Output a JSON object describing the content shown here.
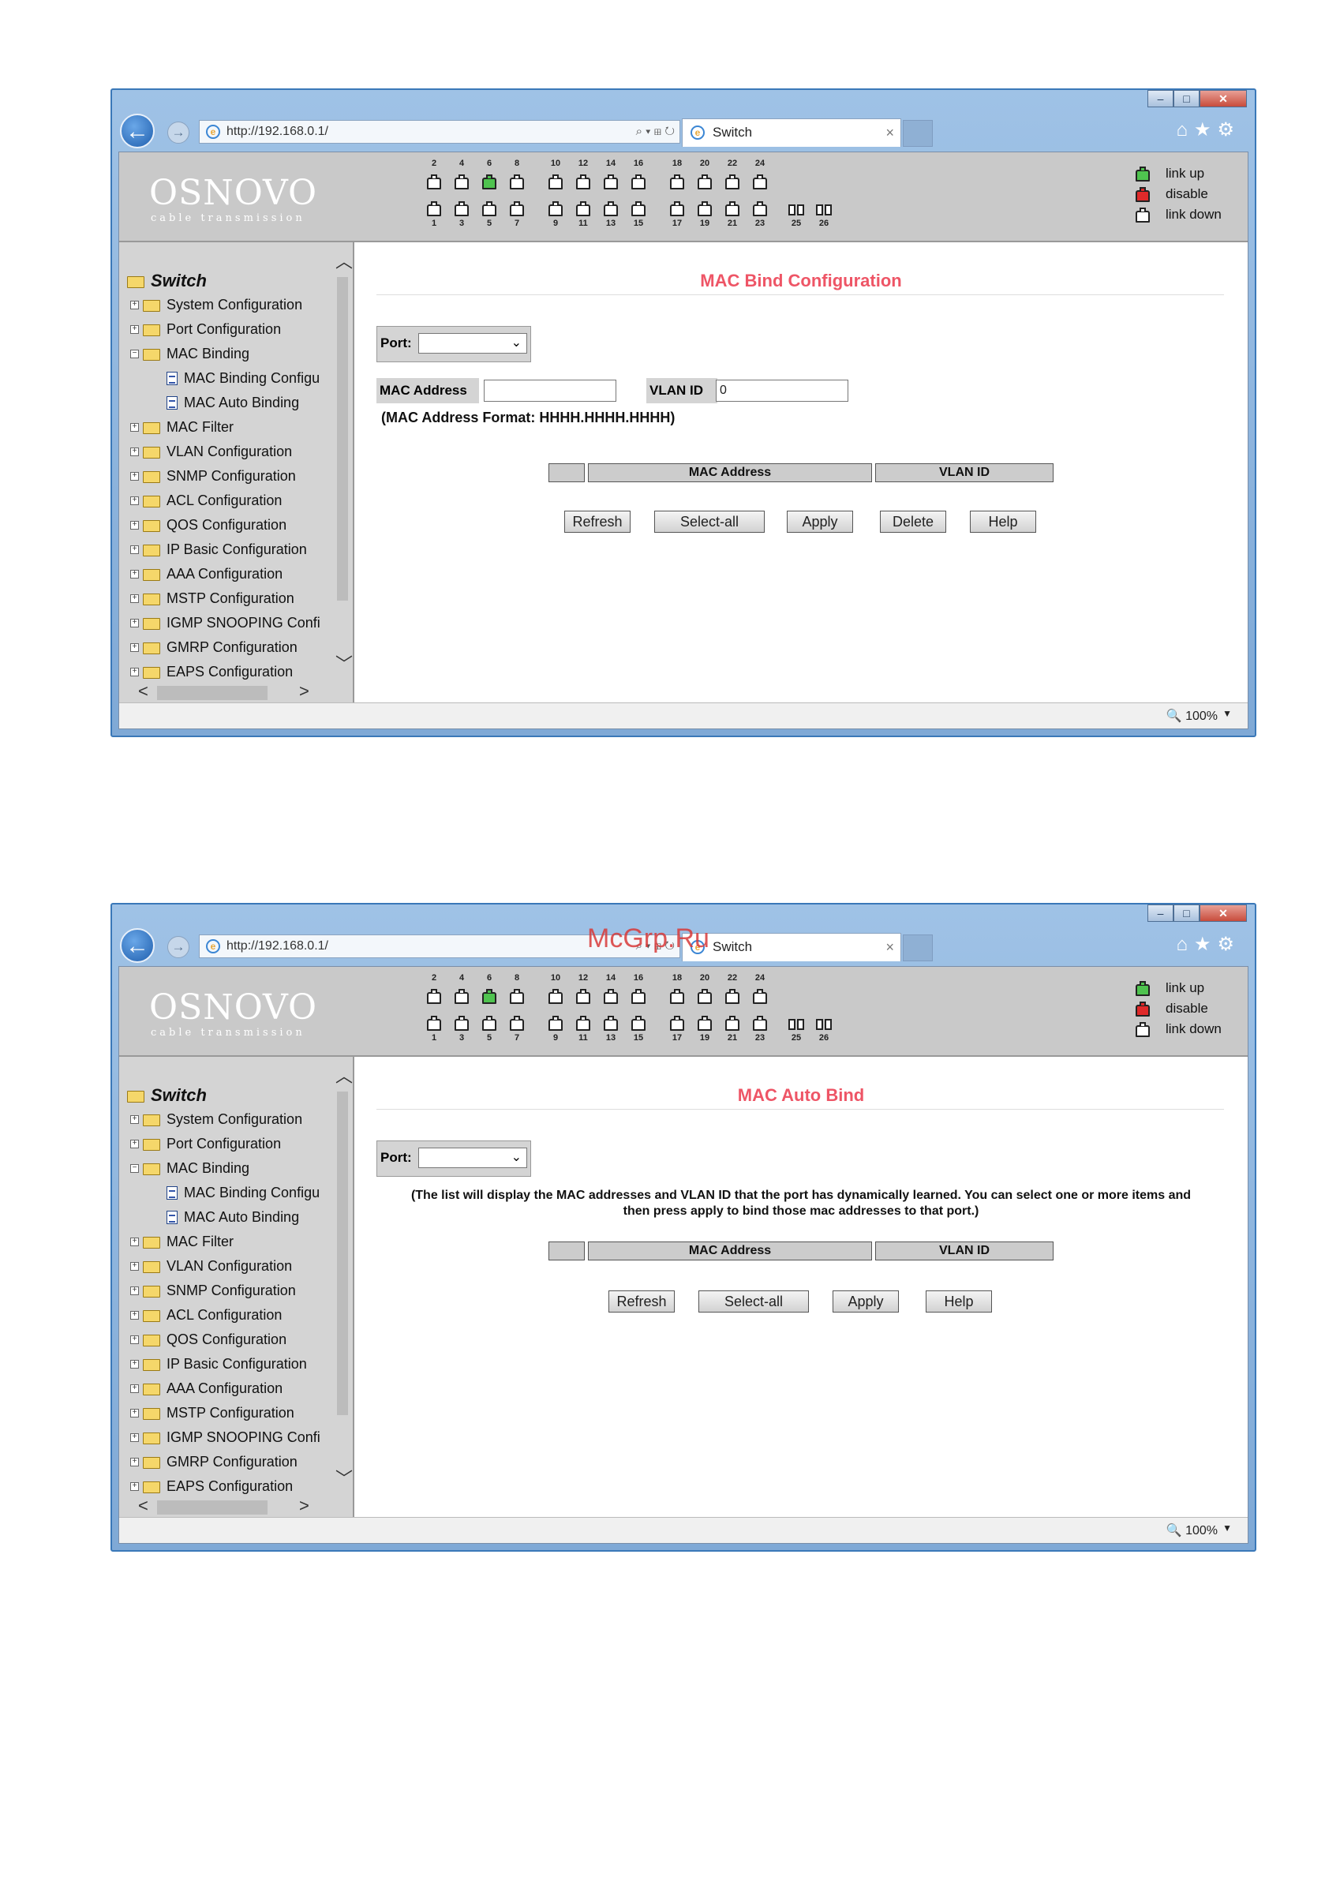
{
  "watermark": "McGrp.Ru",
  "browser": {
    "url": "http://192.168.0.1/",
    "tab_title": "Switch",
    "zoom": "100%"
  },
  "header": {
    "logo": "OSNOVO",
    "logo_sub": "cable transmission",
    "ports_top": [
      "2",
      "4",
      "6",
      "8",
      "10",
      "12",
      "14",
      "16",
      "18",
      "20",
      "22",
      "24"
    ],
    "ports_bottom": [
      "1",
      "3",
      "5",
      "7",
      "9",
      "11",
      "13",
      "15",
      "17",
      "19",
      "21",
      "23"
    ],
    "sfp_ports": [
      "25",
      "26"
    ],
    "legend": [
      {
        "label": "link up",
        "color": "#4fc34f"
      },
      {
        "label": "disable",
        "color": "#e02a2a"
      },
      {
        "label": "link down",
        "color": "#ffffff"
      }
    ]
  },
  "sidebar": {
    "root": "Switch",
    "items": [
      "System Configuration",
      "Port Configuration",
      "MAC Binding",
      "MAC Binding Configu",
      "MAC Auto Binding",
      "MAC Filter",
      "VLAN Configuration",
      "SNMP Configuration",
      "ACL Configuration",
      "QOS Configuration",
      "IP Basic Configuration",
      "AAA Configuration",
      "MSTP Configuration",
      "IGMP SNOOPING Confi",
      "GMRP Configuration",
      "EAPS Configuration"
    ]
  },
  "page1": {
    "title": "MAC Bind Configuration",
    "port_label": "Port:",
    "mac_label": "MAC Address",
    "vlan_label": "VLAN ID",
    "vlan_value": "0",
    "format_note": "(MAC Address Format: HHHH.HHHH.HHHH)",
    "col_mac": "MAC Address",
    "col_vlan": "VLAN ID",
    "buttons": [
      "Refresh",
      "Select-all",
      "Apply",
      "Delete",
      "Help"
    ]
  },
  "page2": {
    "title": "MAC Auto Bind",
    "port_label": "Port:",
    "note_line1": "(The list will display the MAC addresses and VLAN ID that the port has dynamically learned. You can select one or more items and",
    "note_line2": "then press apply to bind those mac addresses to that port.)",
    "col_mac": "MAC Address",
    "col_vlan": "VLAN ID",
    "buttons": [
      "Refresh",
      "Select-all",
      "Apply",
      "Help"
    ]
  }
}
